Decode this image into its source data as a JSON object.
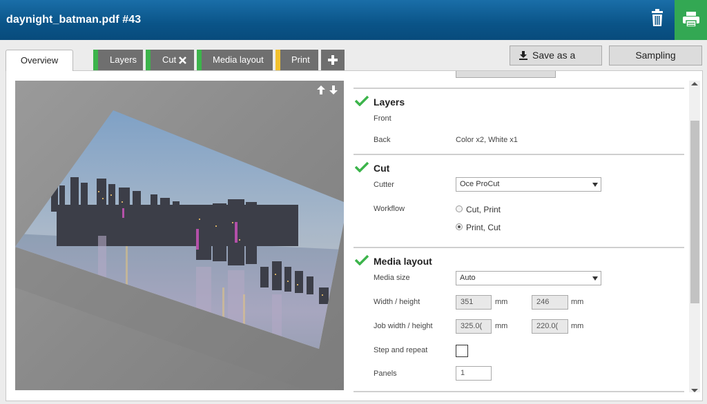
{
  "header": {
    "title": "daynight_batman.pdf #43",
    "trash_icon": "trash-icon",
    "print_icon": "printer-icon",
    "accent_color": "#33a853"
  },
  "tabs": [
    {
      "label": "Overview",
      "status_color": ""
    },
    {
      "label": "Layers",
      "status_color": "#3cb44b"
    },
    {
      "label": "Cut",
      "status_color": "#3cb44b"
    },
    {
      "label": "Media layout",
      "status_color": "#3cb44b"
    },
    {
      "label": "Print",
      "status_color": "#f2c12e"
    }
  ],
  "toolbar": {
    "save_recipe_label": "Save as a recipe",
    "sampling_label": "Sampling"
  },
  "sections": {
    "layers": {
      "title": "Layers",
      "front_label": "Front",
      "back_label": "Back",
      "back_value": "Color x2, White x1"
    },
    "cut": {
      "title": "Cut",
      "cutter_label": "Cutter",
      "cutter_value": "Oce ProCut",
      "workflow_label": "Workflow",
      "workflow_options": [
        "Cut, Print",
        "Print, Cut"
      ],
      "workflow_selected": "Print, Cut"
    },
    "media": {
      "title": "Media layout",
      "media_size_label": "Media size",
      "media_size_value": "Auto",
      "wh_label": "Width / height",
      "width": "351",
      "height": "246",
      "job_wh_label": "Job width / height",
      "job_width": "325.0(",
      "job_height": "220.0(",
      "unit": "mm",
      "step_repeat_label": "Step and repeat",
      "panels_label": "Panels",
      "panels_value": "1"
    }
  }
}
